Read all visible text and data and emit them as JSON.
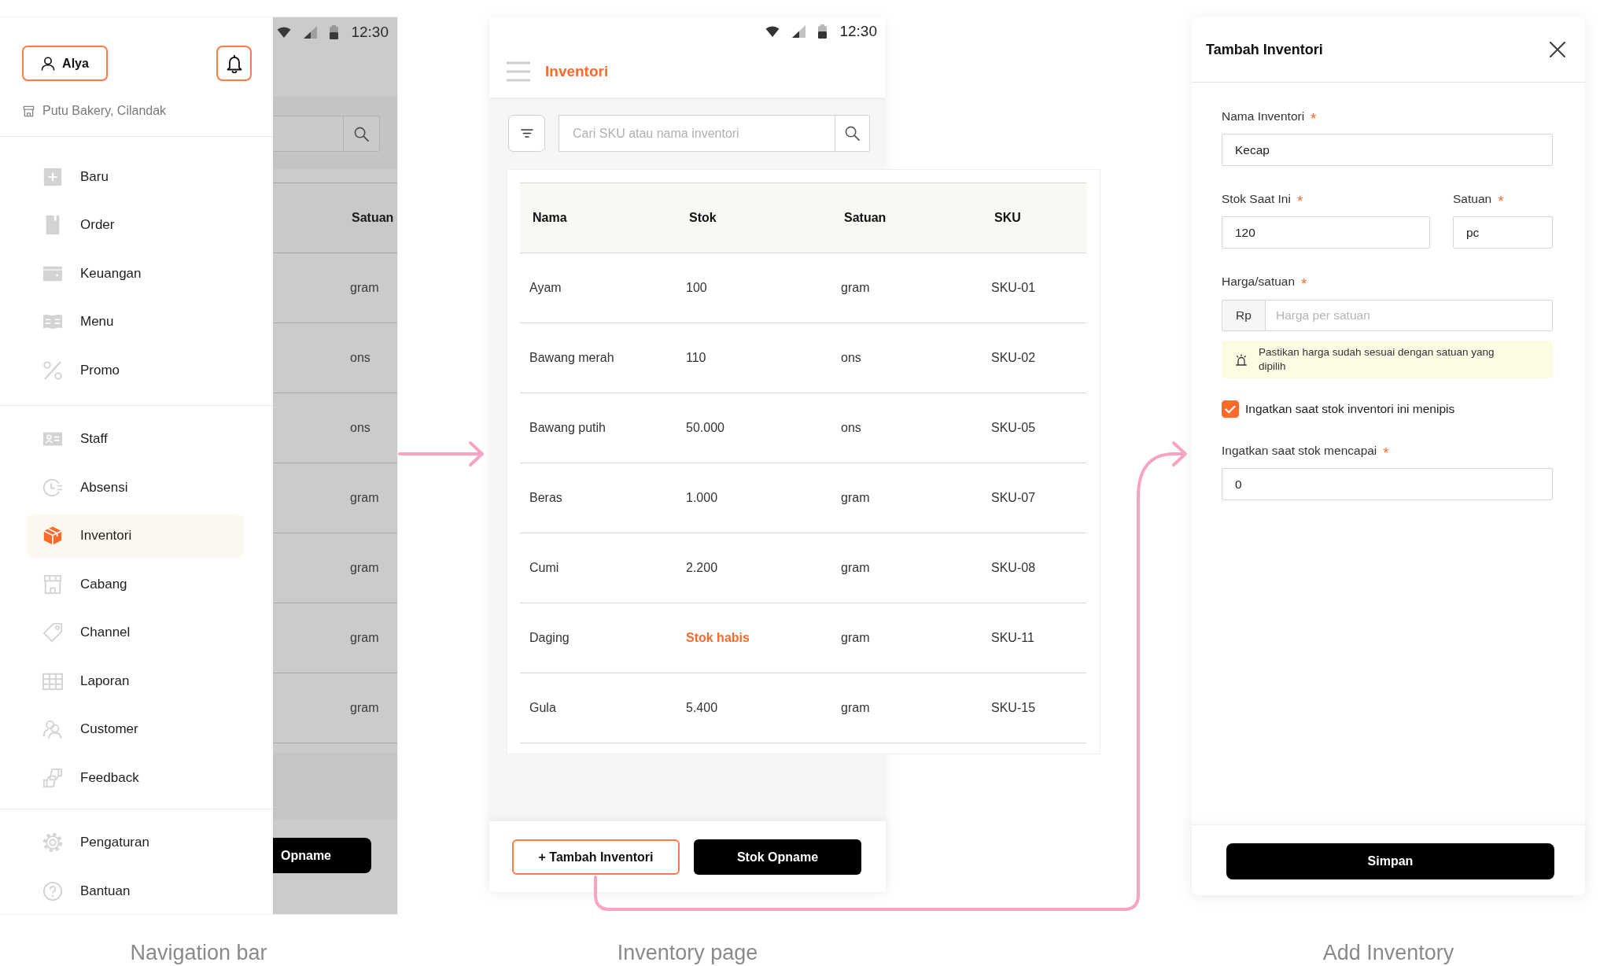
{
  "navigation_screen": {
    "background_page": {
      "time": "12:30",
      "column_header": "Satuan",
      "rows": [
        "gram",
        "ons",
        "ons",
        "gram",
        "gram",
        "gram",
        "gram"
      ],
      "button": "Opname"
    },
    "drawer": {
      "user_button": "Alya",
      "store": "Putu Bakery, Cilandak",
      "groups": [
        {
          "items": [
            {
              "label": "Baru",
              "selected": false
            },
            {
              "label": "Order",
              "selected": false
            },
            {
              "label": "Keuangan",
              "selected": false
            },
            {
              "label": "Menu",
              "selected": false
            },
            {
              "label": "Promo",
              "selected": false
            }
          ]
        },
        {
          "items": [
            {
              "label": "Staff",
              "selected": false
            },
            {
              "label": "Absensi",
              "selected": false
            },
            {
              "label": "Inventori",
              "selected": true
            },
            {
              "label": "Cabang",
              "selected": false
            },
            {
              "label": "Channel",
              "selected": false
            },
            {
              "label": "Laporan",
              "selected": false
            },
            {
              "label": "Customer",
              "selected": false
            },
            {
              "label": "Feedback",
              "selected": false
            }
          ]
        },
        {
          "items": [
            {
              "label": "Pengaturan",
              "selected": false
            },
            {
              "label": "Bantuan",
              "selected": false
            }
          ]
        }
      ]
    },
    "caption": "Navigation bar"
  },
  "inventory_screen": {
    "time": "12:30",
    "title": "Inventori",
    "search": {
      "placeholder": "Cari SKU atau nama inventori"
    },
    "table": {
      "columns": [
        "Nama",
        "Stok",
        "Satuan",
        "SKU"
      ],
      "rows": [
        {
          "cells": [
            "Ayam",
            "100",
            "gram",
            "SKU-01"
          ],
          "out_of_stock": false
        },
        {
          "cells": [
            "Bawang merah",
            "110",
            "ons",
            "SKU-02"
          ],
          "out_of_stock": false
        },
        {
          "cells": [
            "Bawang putih",
            "50.000",
            "ons",
            "SKU-05"
          ],
          "out_of_stock": false
        },
        {
          "cells": [
            "Beras",
            "1.000",
            "gram",
            "SKU-07"
          ],
          "out_of_stock": false
        },
        {
          "cells": [
            "Cumi",
            "2.200",
            "gram",
            "SKU-08"
          ],
          "out_of_stock": false
        },
        {
          "cells": [
            "Daging",
            "Stok habis",
            "gram",
            "SKU-11"
          ],
          "out_of_stock": true
        },
        {
          "cells": [
            "Gula",
            "5.400",
            "gram",
            "SKU-15"
          ],
          "out_of_stock": false
        }
      ]
    },
    "buttons": [
      {
        "label": "+ Tambah Inventori",
        "kind": "outline"
      },
      {
        "label": "Stok Opname",
        "kind": "solid"
      }
    ],
    "caption": "Inventory page"
  },
  "add_inventory_screen": {
    "title": "Tambah Inventori",
    "form": [
      {
        "kind": "field",
        "label": "Nama Inventori",
        "required_mark": "*",
        "value": "Kecap"
      },
      {
        "kind": "pair",
        "fields": [
          {
            "label": "Stok Saat Ini",
            "required_mark": "*",
            "value": "120"
          },
          {
            "label": "Satuan",
            "required_mark": "*",
            "value": "pc"
          }
        ]
      },
      {
        "kind": "prefixed",
        "label": "Harga/satuan",
        "required_mark": "*",
        "prefix": "Rp",
        "placeholder": "Harga per satuan"
      },
      {
        "kind": "alert",
        "text": "Pastikan harga sudah sesuai dengan satuan yang dipilih"
      },
      {
        "kind": "checkbox",
        "label": "Ingatkan saat stok inventori ini menipis",
        "checked": true
      },
      {
        "kind": "field",
        "label": "Ingatkan saat stok mencapai",
        "required_mark": "*",
        "value": "0"
      }
    ],
    "submit": "Simpan",
    "caption": "Add Inventory"
  }
}
